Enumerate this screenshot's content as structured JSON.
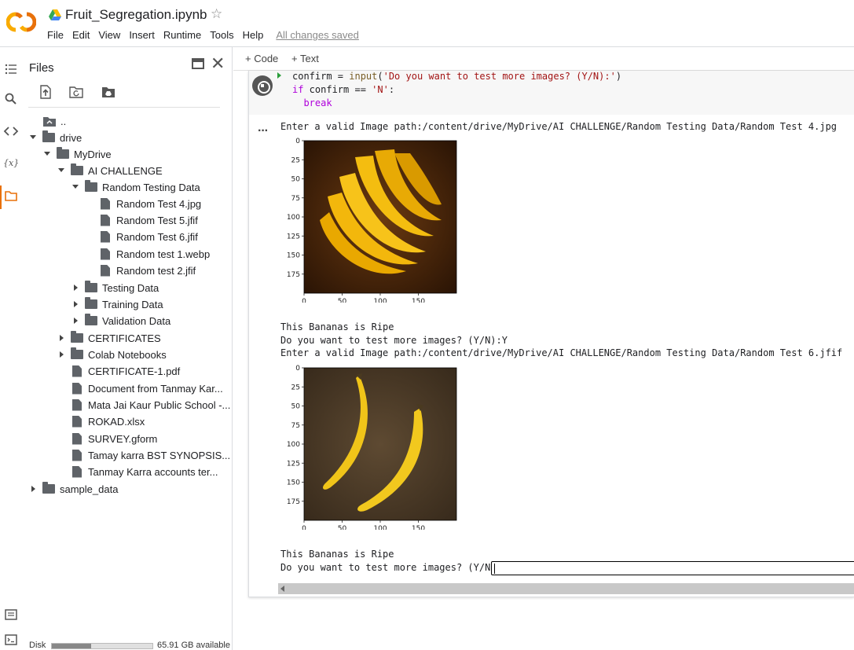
{
  "header": {
    "notebook_title": "Fruit_Segregation.ipynb",
    "menu": [
      "File",
      "Edit",
      "View",
      "Insert",
      "Runtime",
      "Tools",
      "Help"
    ],
    "save_status": "All changes saved"
  },
  "files_panel": {
    "title": "Files",
    "tree": [
      {
        "label": "..",
        "kind": "parent"
      },
      {
        "label": "drive",
        "kind": "folder",
        "state": "open"
      },
      {
        "label": "MyDrive",
        "kind": "folder",
        "state": "open"
      },
      {
        "label": "AI CHALLENGE",
        "kind": "folder",
        "state": "open"
      },
      {
        "label": "Random Testing Data",
        "kind": "folder",
        "state": "open"
      },
      {
        "label": "Random Test 4.jpg",
        "kind": "file"
      },
      {
        "label": "Random Test 5.jfif",
        "kind": "file"
      },
      {
        "label": "Random Test 6.jfif",
        "kind": "file"
      },
      {
        "label": "Random test 1.webp",
        "kind": "file"
      },
      {
        "label": "Random test 2.jfif",
        "kind": "file"
      },
      {
        "label": "Testing Data",
        "kind": "folder",
        "state": "closed"
      },
      {
        "label": "Training Data",
        "kind": "folder",
        "state": "closed"
      },
      {
        "label": "Validation Data",
        "kind": "folder",
        "state": "closed"
      },
      {
        "label": "CERTIFICATES",
        "kind": "folder",
        "state": "closed"
      },
      {
        "label": "Colab Notebooks",
        "kind": "folder",
        "state": "closed"
      },
      {
        "label": "CERTIFICATE-1.pdf",
        "kind": "file"
      },
      {
        "label": "Document from Tanmay Kar...",
        "kind": "file"
      },
      {
        "label": "Mata Jai Kaur Public School -...",
        "kind": "file"
      },
      {
        "label": "ROKAD.xlsx",
        "kind": "file"
      },
      {
        "label": "SURVEY.gform",
        "kind": "file"
      },
      {
        "label": "Tamay karra BST SYNOPSIS...",
        "kind": "file"
      },
      {
        "label": "Tanmay Karra accounts ter...",
        "kind": "file"
      },
      {
        "label": "sample_data",
        "kind": "folder",
        "state": "closed"
      }
    ],
    "disk_label": "Disk",
    "disk_available": "65.91 GB available",
    "disk_used_fraction": 0.39
  },
  "toolbar": {
    "code_label": "+ Code",
    "text_label": "+ Text"
  },
  "cell": {
    "code_lines": [
      {
        "pre": "confirm = ",
        "fn": "input",
        "post": "(",
        "str": "'Do you want to test more images? (Y/N):'",
        "end": ")"
      },
      {
        "kw": "if",
        "mid": " confirm == ",
        "str": "'N'",
        "end": ":"
      },
      {
        "indent": "  ",
        "kw": "break"
      }
    ],
    "output": {
      "line1": "Enter a valid Image path:/content/drive/MyDrive/AI CHALLENGE/Random Testing Data/Random Test 4.jpg",
      "result1": "This Bananas is Ripe",
      "prompt1": "Do you want to test more images? (Y/N):Y",
      "line2": "Enter a valid Image path:/content/drive/MyDrive/AI CHALLENGE/Random Testing Data/Random Test 6.jfif",
      "result2": "This Bananas is Ripe",
      "prompt2": "Do you want to test more images? (Y/N):"
    },
    "plot_axes": {
      "y_ticks": [
        "0",
        "25",
        "50",
        "75",
        "100",
        "125",
        "150",
        "175"
      ],
      "x_ticks": [
        "0",
        "50",
        "100",
        "150"
      ]
    }
  }
}
